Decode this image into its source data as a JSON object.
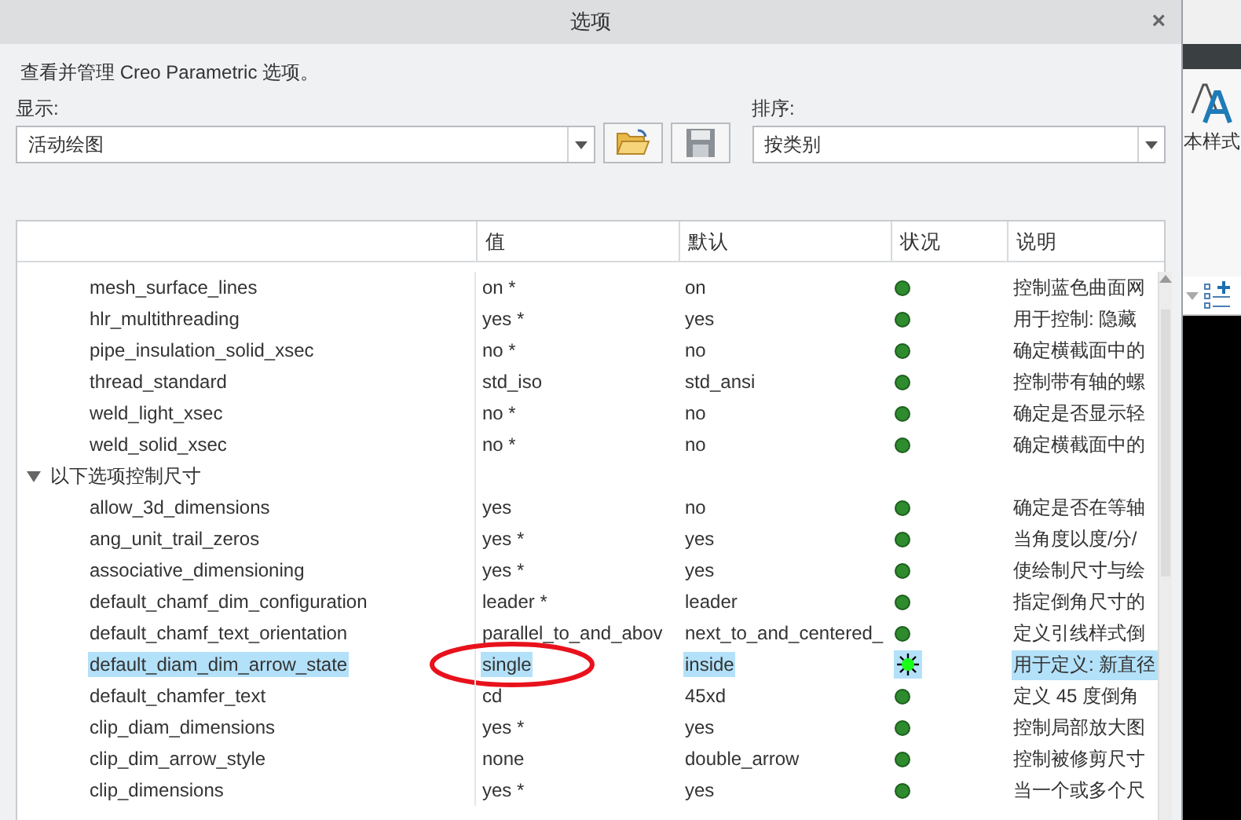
{
  "window": {
    "title": "选项",
    "close": "×"
  },
  "description": "查看并管理 Creo Parametric 选项。",
  "display": {
    "label": "显示:",
    "value": "活动绘图"
  },
  "sort": {
    "label": "排序:",
    "value": "按类别"
  },
  "table": {
    "columns": [
      "值",
      "默认",
      "状况",
      "说明"
    ],
    "rows": [
      {
        "kind": "option",
        "name": "mesh_surface_lines",
        "value": "on *",
        "default": "on",
        "modified": false,
        "note": "控制蓝色曲面网",
        "selected": false,
        "circled": false
      },
      {
        "kind": "option",
        "name": "hlr_multithreading",
        "value": "yes *",
        "default": "yes",
        "modified": false,
        "note": "用于控制: 隐藏",
        "selected": false,
        "circled": false
      },
      {
        "kind": "option",
        "name": "pipe_insulation_solid_xsec",
        "value": "no *",
        "default": "no",
        "modified": false,
        "note": "确定横截面中的",
        "selected": false,
        "circled": false
      },
      {
        "kind": "option",
        "name": "thread_standard",
        "value": "std_iso",
        "default": "std_ansi",
        "modified": false,
        "note": "控制带有轴的螺",
        "selected": false,
        "circled": false
      },
      {
        "kind": "option",
        "name": "weld_light_xsec",
        "value": "no *",
        "default": "no",
        "modified": false,
        "note": "确定是否显示轻",
        "selected": false,
        "circled": false
      },
      {
        "kind": "option",
        "name": "weld_solid_xsec",
        "value": "no *",
        "default": "no",
        "modified": false,
        "note": "确定横截面中的",
        "selected": false,
        "circled": false
      },
      {
        "kind": "group",
        "name": "以下选项控制尺寸",
        "expanded": true
      },
      {
        "kind": "option",
        "name": "allow_3d_dimensions",
        "value": "yes",
        "default": "no",
        "modified": false,
        "note": "确定是否在等轴",
        "selected": false,
        "circled": false
      },
      {
        "kind": "option",
        "name": "ang_unit_trail_zeros",
        "value": "yes *",
        "default": "yes",
        "modified": false,
        "note": "当角度以度/分/",
        "selected": false,
        "circled": false
      },
      {
        "kind": "option",
        "name": "associative_dimensioning",
        "value": "yes *",
        "default": "yes",
        "modified": false,
        "note": "使绘制尺寸与绘",
        "selected": false,
        "circled": false
      },
      {
        "kind": "option",
        "name": "default_chamf_dim_configuration",
        "value": "leader *",
        "default": "leader",
        "modified": false,
        "note": "指定倒角尺寸的",
        "selected": false,
        "circled": false
      },
      {
        "kind": "option",
        "name": "default_chamf_text_orientation",
        "value": "parallel_to_and_abov",
        "default": "next_to_and_centered_",
        "modified": false,
        "note": "定义引线样式倒",
        "selected": false,
        "circled": false
      },
      {
        "kind": "option",
        "name": "default_diam_dim_arrow_state",
        "value": "single",
        "default": "inside",
        "modified": true,
        "note": "用于定义: 新直径",
        "selected": true,
        "circled": true
      },
      {
        "kind": "option",
        "name": "default_chamfer_text",
        "value": "cd",
        "default": "45xd",
        "modified": false,
        "note": "定义 45 度倒角",
        "selected": false,
        "circled": false
      },
      {
        "kind": "option",
        "name": "clip_diam_dimensions",
        "value": "yes *",
        "default": "yes",
        "modified": false,
        "note": "控制局部放大图",
        "selected": false,
        "circled": false
      },
      {
        "kind": "option",
        "name": "clip_dim_arrow_style",
        "value": "none",
        "default": "double_arrow",
        "modified": false,
        "note": "控制被修剪尺寸",
        "selected": false,
        "circled": false
      },
      {
        "kind": "option",
        "name": "clip_dimensions",
        "value": "yes *",
        "default": "yes",
        "modified": false,
        "note": "当一个或多个尺",
        "selected": false,
        "circled": false
      }
    ]
  },
  "background_app": {
    "ribbon_label": "本样式"
  }
}
